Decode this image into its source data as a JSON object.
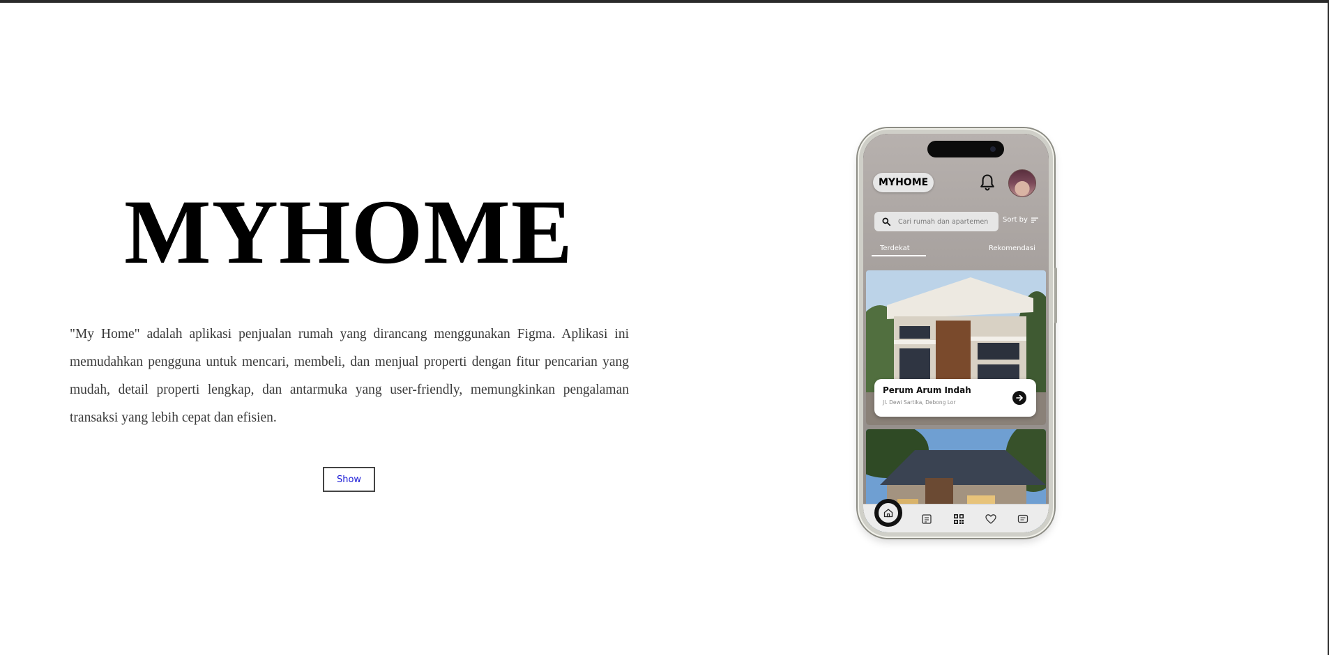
{
  "hero": {
    "title": "MYHOME",
    "description": "\"My Home\" adalah aplikasi penjualan rumah yang dirancang menggunakan Figma. Aplikasi ini memudahkan pengguna untuk mencari, membeli, dan menjual properti dengan fitur pencarian yang mudah, detail properti lengkap, dan antarmuka yang user-friendly, memungkinkan pengalaman transaksi yang lebih cepat dan efisien.",
    "show_label": "Show"
  },
  "phone": {
    "brand": "MYHOME",
    "search": {
      "placeholder": "Cari rumah dan apartemen"
    },
    "sort_label": "Sort by",
    "tabs": [
      {
        "label": "Terdekat",
        "active": true
      },
      {
        "label": "Rekomendasi",
        "active": false
      }
    ],
    "listings": [
      {
        "title": "Perum Arum Indah",
        "address": "Jl. Dewi Sartika, Debong Lor"
      }
    ],
    "bottom_nav": [
      "home-icon",
      "news-icon",
      "qr-code-icon",
      "heart-icon",
      "chat-icon"
    ]
  },
  "colors": {
    "link_blue": "#1a1ad6",
    "text_gray": "#3a3a3a",
    "accent_dark": "#111111"
  }
}
